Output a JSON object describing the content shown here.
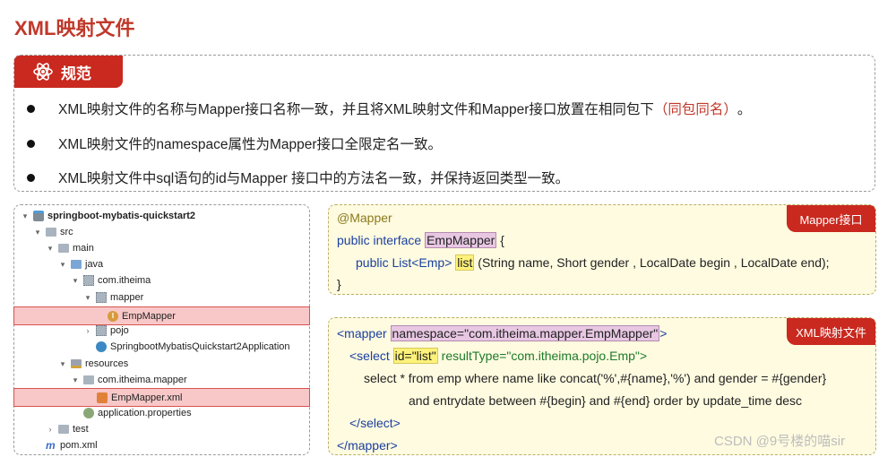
{
  "title": "XML映射文件",
  "rules": {
    "tab_label": "规范",
    "items": [
      {
        "text": "XML映射文件的名称与Mapper接口名称一致，并且将XML映射文件和Mapper接口放置在相同包下",
        "highlight": "（同包同名）",
        "tail": "。"
      },
      {
        "text": "XML映射文件的namespace属性为Mapper接口全限定名一致。",
        "highlight": "",
        "tail": ""
      },
      {
        "text": "XML映射文件中sql语句的id与Mapper 接口中的方法名一致，并保持返回类型一致。",
        "highlight": "",
        "tail": ""
      }
    ]
  },
  "tree": {
    "items": [
      {
        "label": "springboot-mybatis-quickstart2"
      },
      {
        "label": "src"
      },
      {
        "label": "main"
      },
      {
        "label": "java"
      },
      {
        "label": "com.itheima"
      },
      {
        "label": "mapper"
      },
      {
        "label": "EmpMapper"
      },
      {
        "label": "pojo"
      },
      {
        "label": "SpringbootMybatisQuickstart2Application"
      },
      {
        "label": "resources"
      },
      {
        "label": "com.itheima.mapper"
      },
      {
        "label": "EmpMapper.xml"
      },
      {
        "label": "application.properties"
      },
      {
        "label": "test"
      },
      {
        "label": "pom.xml"
      }
    ]
  },
  "mapper_code": {
    "tag": "Mapper接口",
    "annotation": "@Mapper",
    "decl_prefix": "public interface ",
    "interface_name": "EmpMapper",
    "decl_suffix": " {",
    "method_prefix": "public List<Emp> ",
    "method_name": "list",
    "method_suffix": " (String name, Short gender , LocalDate begin , LocalDate end);",
    "close": "}"
  },
  "xml_code": {
    "tag": "XML映射文件",
    "open_tag": "<mapper ",
    "namespace_attr": "namespace=\"com.itheima.mapper.EmpMapper\"",
    "open_end": ">",
    "select_open": "<select ",
    "id_attr": "id=\"list\"",
    "result_type_attr": " resultType=\"com.itheima.pojo.Emp\">",
    "sql_line1": "select * from emp where name like concat('%',#{name},'%') and gender = #{gender}",
    "sql_line2": "and entrydate between #{begin} and #{end} order by update_time desc",
    "select_close": "</select>",
    "mapper_close": "</mapper>"
  },
  "watermark": "CSDN @9号楼的喵sir",
  "colors": {
    "accent": "#c9291f",
    "code_bg": "#fffbe0",
    "highlight_purple": "#e8c7e3",
    "highlight_yellow": "#fff27a"
  }
}
